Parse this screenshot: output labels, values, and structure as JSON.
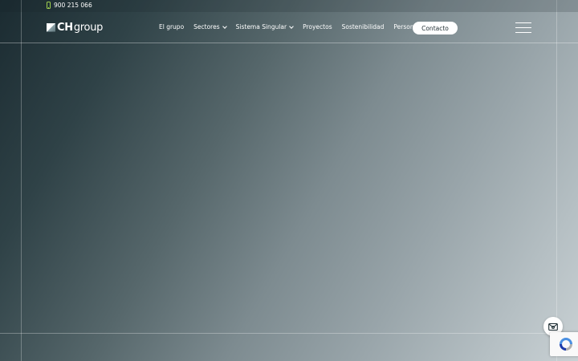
{
  "topbar": {
    "phone_icon": "phone-icon",
    "phone": "900 215 066"
  },
  "header": {
    "logo": {
      "strong": "CH",
      "light": "group"
    },
    "nav": [
      {
        "label": "El grupo",
        "dropdown": false
      },
      {
        "label": "Sectores",
        "dropdown": true
      },
      {
        "label": "Sistema Singular",
        "dropdown": true
      },
      {
        "label": "Proyectos",
        "dropdown": false
      },
      {
        "label": "Sostenibilidad",
        "dropdown": false
      },
      {
        "label": "Personas",
        "dropdown": false
      }
    ],
    "contact_label": "Contacto",
    "menu_icon": "hamburger-menu-icon"
  },
  "widgets": {
    "mail_icon": "mail-icon",
    "recaptcha_icon": "recaptcha-icon"
  },
  "colors": {
    "accent_green": "#9fd04e",
    "white": "#ffffff",
    "dark": "#1b2b31"
  }
}
